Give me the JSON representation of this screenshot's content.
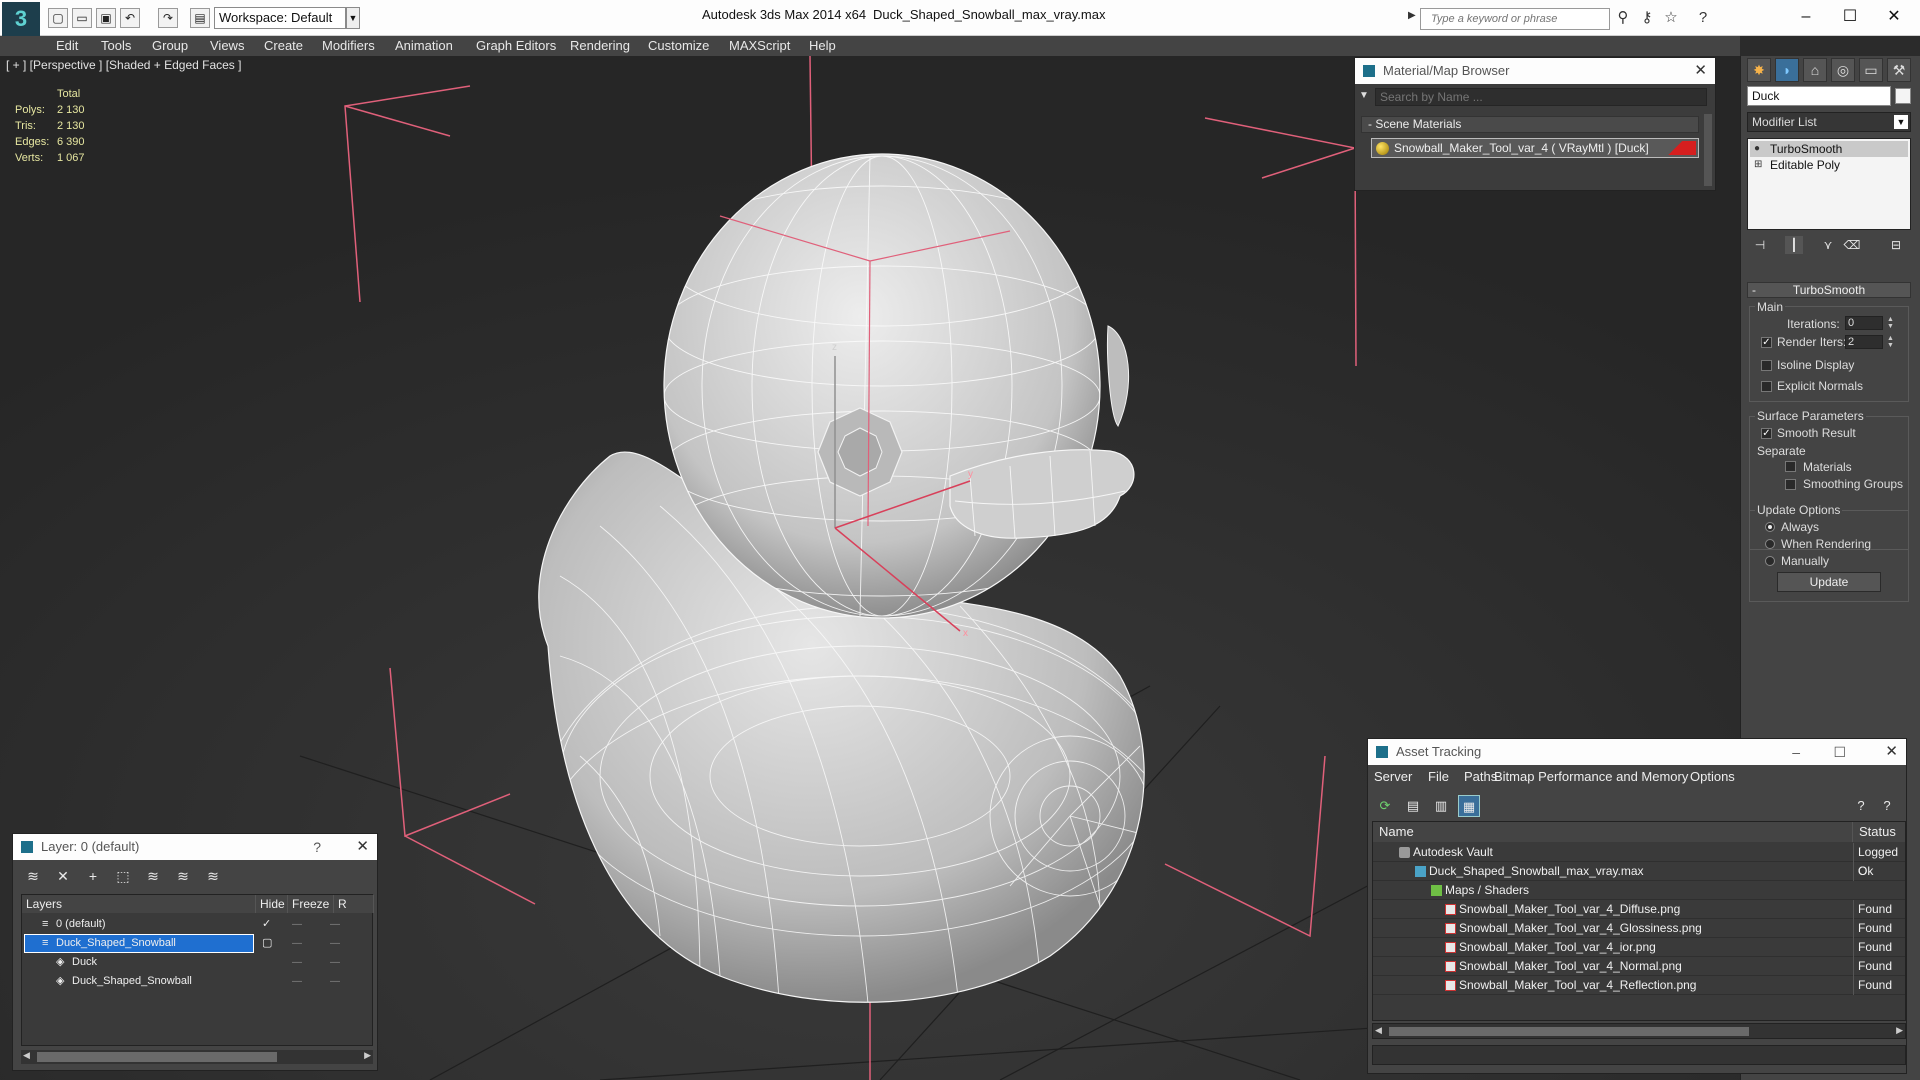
{
  "titlebar": {
    "workspace": "Workspace: Default",
    "app_title": "Autodesk 3ds Max  2014 x64",
    "file_title": "Duck_Shaped_Snowball_max_vray.max",
    "search_placeholder": "Type a keyword or phrase",
    "icons": [
      "new-file-icon",
      "open-file-icon",
      "save-icon",
      "undo-icon",
      "redo-icon",
      "project-folder-icon",
      "binoculars-icon",
      "key-icon",
      "star-icon",
      "help-icon"
    ]
  },
  "menu": [
    "Edit",
    "Tools",
    "Group",
    "Views",
    "Create",
    "Modifiers",
    "Animation",
    "Graph Editors",
    "Rendering",
    "Customize",
    "MAXScript",
    "Help"
  ],
  "viewport": {
    "label": "[ + ] [Perspective ] [Shaded + Edged Faces ]",
    "stats_total": "Total",
    "stats": [
      {
        "key": "Polys:",
        "value": "2 130"
      },
      {
        "key": "Tris:",
        "value": "2 130"
      },
      {
        "key": "Edges:",
        "value": "6 390"
      },
      {
        "key": "Verts:",
        "value": "1 067"
      }
    ],
    "gizmo_labels": {
      "x": "x",
      "y": "y",
      "z": "z"
    }
  },
  "material_browser": {
    "title": "Material/Map Browser",
    "search_placeholder": "Search by Name ...",
    "section": "- Scene Materials",
    "entry": "Snowball_Maker_Tool_var_4  ( VRayMtl )  [Duck]"
  },
  "command_panel": {
    "object_name": "Duck",
    "modifier_list": "Modifier List",
    "stack": [
      "TurboSmooth",
      "Editable Poly"
    ],
    "rollout_title": "TurboSmooth",
    "main_label": "Main",
    "iterations_label": "Iterations:",
    "iterations_value": "0",
    "render_iters_label": "Render Iters:",
    "render_iters_value": "2",
    "render_iters_checked": true,
    "isoline_label": "Isoline Display",
    "explicit_normals_label": "Explicit Normals",
    "surface_params_label": "Surface Parameters",
    "smooth_result_label": "Smooth Result",
    "separate_label": "Separate",
    "materials_label": "Materials",
    "smoothing_groups_label": "Smoothing Groups",
    "update_options_label": "Update Options",
    "always_label": "Always",
    "when_rendering_label": "When Rendering",
    "manually_label": "Manually",
    "update_button": "Update"
  },
  "layer_panel": {
    "title": "Layer: 0 (default)",
    "help": "?",
    "columns": [
      "Layers",
      "Hide",
      "Freeze",
      "R"
    ],
    "rows": [
      {
        "name": "0 (default)"
      },
      {
        "name": "Duck_Shaped_Snowball"
      },
      {
        "name": "Duck"
      },
      {
        "name": "Duck_Shaped_Snowball"
      }
    ]
  },
  "asset_panel": {
    "title": "Asset Tracking",
    "menu": [
      "Server",
      "File",
      "Paths",
      "Bitmap Performance and Memory",
      "Options"
    ],
    "columns": [
      "Name",
      "Status"
    ],
    "rows": [
      {
        "name": "Autodesk Vault",
        "status": "Logged O"
      },
      {
        "name": "Duck_Shaped_Snowball_max_vray.max",
        "status": "Ok"
      },
      {
        "name": "Maps / Shaders",
        "status": ""
      },
      {
        "name": "Snowball_Maker_Tool_var_4_Diffuse.png",
        "status": "Found"
      },
      {
        "name": "Snowball_Maker_Tool_var_4_Glossiness.png",
        "status": "Found"
      },
      {
        "name": "Snowball_Maker_Tool_var_4_ior.png",
        "status": "Found"
      },
      {
        "name": "Snowball_Maker_Tool_var_4_Normal.png",
        "status": "Found"
      },
      {
        "name": "Snowball_Maker_Tool_var_4_Reflection.png",
        "status": "Found"
      }
    ]
  },
  "colors": {
    "accent_selection": "#1f6fd0",
    "stats_text": "#e6e6a0",
    "bounding_box": "#e0607a",
    "material_swatch": "#d61f1f"
  }
}
